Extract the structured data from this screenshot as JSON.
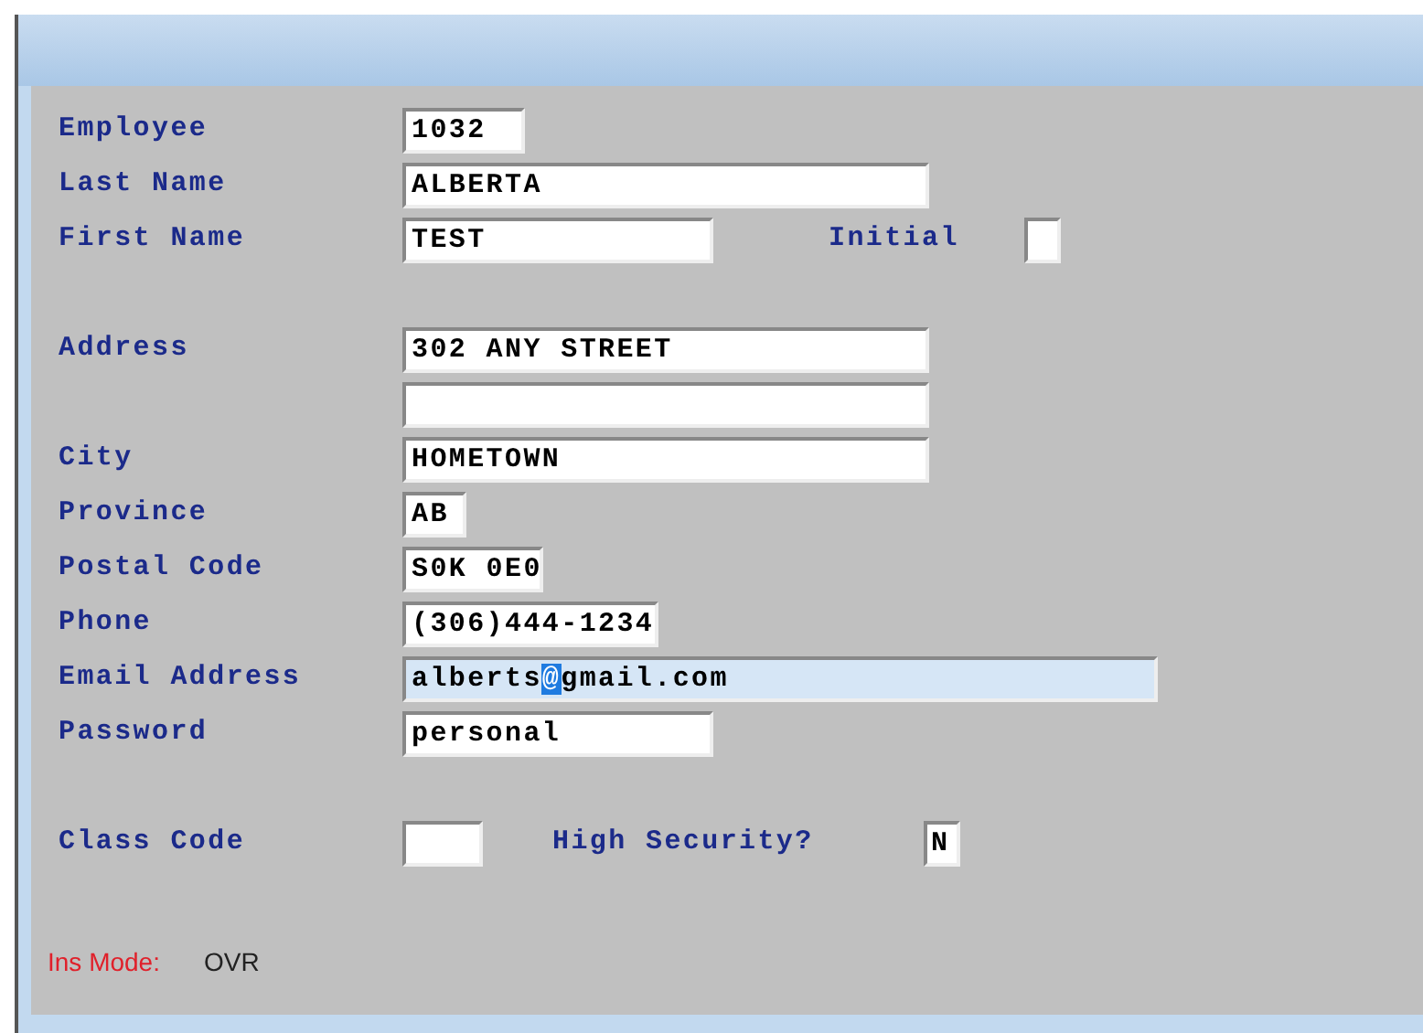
{
  "rows": [
    {
      "label": "Employee",
      "value": "1032"
    },
    {
      "label": "Last Name",
      "value": "ALBERTA"
    },
    {
      "label": "First Name",
      "value": "TEST",
      "extra": {
        "label": "Initial"
      }
    },
    {
      "label": "Address",
      "value": "302 ANY STREET"
    },
    {},
    {
      "label": "City",
      "value": "HOMETOWN"
    },
    {
      "label": "Province",
      "value": "AB"
    },
    {
      "label": "Postal Code",
      "value": "S0K 0E0"
    },
    {
      "label": "Phone",
      "value": "(306)444-1234"
    },
    {
      "label": "Email Address",
      "value_before_cursor": "alberts",
      "cursor_char": "@",
      "value_after_cursor": "gmail.com",
      "focused": true
    },
    {
      "label": "Password",
      "value": "personal"
    },
    {
      "label": "Class Code",
      "extra": {
        "label": "High Security?",
        "value": "N"
      }
    }
  ],
  "status": {
    "label": "Ins Mode:",
    "value": "OVR"
  }
}
